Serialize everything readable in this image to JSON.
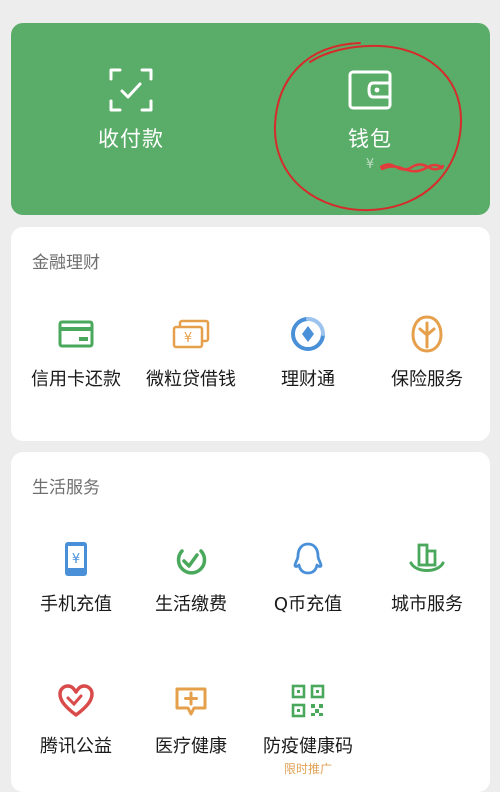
{
  "hero": {
    "pay_label": "收付款",
    "wallet_label": "钱包",
    "wallet_balance": "¥"
  },
  "finance": {
    "title": "金融理财",
    "items": [
      {
        "label": "信用卡还款",
        "icon": "credit-card-icon"
      },
      {
        "label": "微粒贷借钱",
        "icon": "cash-icon"
      },
      {
        "label": "理财通",
        "icon": "wealth-icon"
      },
      {
        "label": "保险服务",
        "icon": "insurance-icon"
      }
    ]
  },
  "life": {
    "title": "生活服务",
    "items": [
      {
        "label": "手机充值",
        "icon": "phone-icon"
      },
      {
        "label": "生活缴费",
        "icon": "utility-icon"
      },
      {
        "label": "Q币充值",
        "icon": "qq-icon"
      },
      {
        "label": "城市服务",
        "icon": "city-icon"
      },
      {
        "label": "腾讯公益",
        "icon": "charity-icon"
      },
      {
        "label": "医疗健康",
        "icon": "medical-icon"
      },
      {
        "label": "防疫健康码",
        "icon": "qr-code-icon",
        "promo": "限时推广"
      }
    ]
  },
  "colors": {
    "hero_bg": "#5aac69",
    "green": "#49a85b",
    "orange": "#e6a04c",
    "blue": "#4a90d9",
    "red": "#d94b4b",
    "annotation": "#d62b2b"
  }
}
